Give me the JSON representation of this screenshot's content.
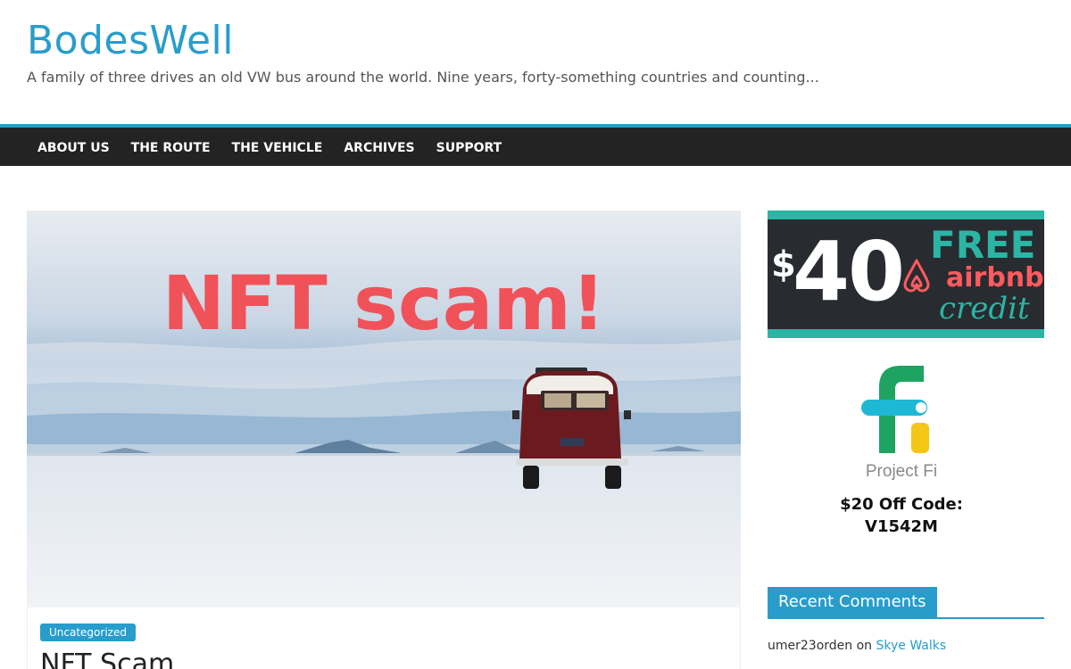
{
  "site": {
    "title": "BodesWell",
    "description": "A family of three drives an old VW bus around the world. Nine years, forty-something countries and counting..."
  },
  "nav": {
    "items": [
      "ABOUT US",
      "THE ROUTE",
      "THE VEHICLE",
      "ARCHIVES",
      "SUPPORT"
    ]
  },
  "post": {
    "image_text": "NFT scam!",
    "category": "Uncategorized",
    "title": "NFT Scam"
  },
  "sidebar": {
    "airbnb_ad": {
      "dollar": "$",
      "amount": "40",
      "free": "FREE",
      "brand": "airbnb",
      "credit": "credit"
    },
    "fi": {
      "label": "Project Fi",
      "code_line1": "$20 Off Code:",
      "code_line2": "V1542M"
    },
    "recent_comments": {
      "title": "Recent Comments",
      "items": [
        {
          "author": "umer23orden",
          "on": "on",
          "post": "Skye Walks"
        }
      ]
    }
  },
  "colors": {
    "accent": "#289dcc",
    "nav_bg": "#232323",
    "scam_red": "#f0525a",
    "airbnb_teal": "#2bb5a5",
    "airbnb_red": "#ff5a5f"
  }
}
